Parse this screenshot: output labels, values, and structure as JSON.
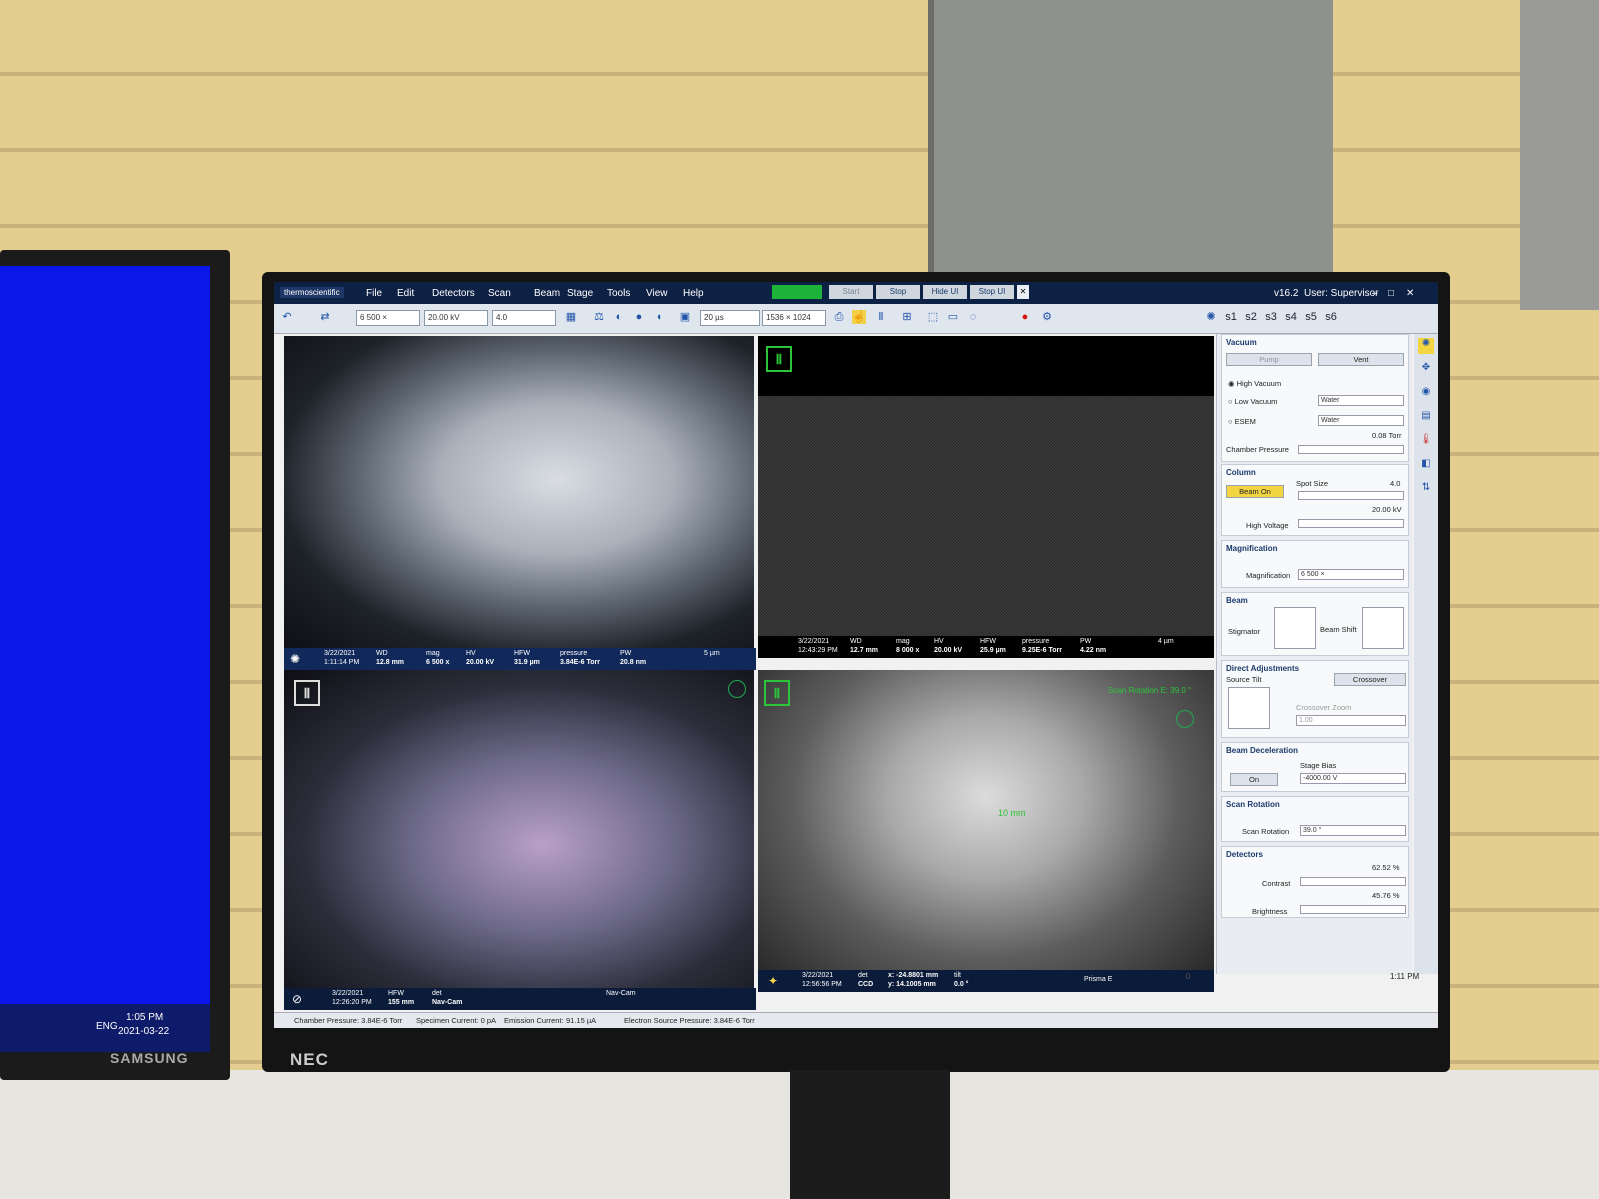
{
  "left_monitor": {
    "brand": "SAMSUNG",
    "time": "1:05 PM",
    "date": "2021-03-22",
    "lang": "ENG"
  },
  "monitor_brand": "NEC",
  "menubar": {
    "logo": "thermoscientific",
    "menus": [
      "File",
      "Edit",
      "Detectors",
      "Scan",
      "Beam",
      "Stage",
      "Tools",
      "View",
      "Help"
    ],
    "start": "Start",
    "stop": "Stop",
    "hide_ui": "Hide UI",
    "stop_ui": "Stop UI",
    "version": "v16.2",
    "user": "User: Supervisor"
  },
  "toolbar": {
    "magnification": "6 500 ×",
    "voltage": "20.00 kV",
    "spot": "4.0",
    "dwell": "20 µs",
    "resolution": "1536 × 1024",
    "slots": [
      "s1",
      "s2",
      "s3",
      "s4",
      "s5",
      "s6"
    ]
  },
  "quad1": {
    "date": "3/22/2021",
    "time": "1:11:14 PM",
    "wd_label": "WD",
    "wd": "12.8 mm",
    "mag_label": "mag",
    "mag": "6 500 x",
    "hv_label": "HV",
    "hv": "20.00 kV",
    "hfw_label": "HFW",
    "hfw": "31.9 µm",
    "pressure_label": "pressure",
    "pressure": "3.84E-6 Torr",
    "pw_label": "PW",
    "pw": "20.8 nm",
    "scale": "5 µm"
  },
  "quad2": {
    "date": "3/22/2021",
    "time": "12:43:29 PM",
    "wd_label": "WD",
    "wd": "12.7 mm",
    "mag_label": "mag",
    "mag": "8 000 x",
    "hv_label": "HV",
    "hv": "20.00 kV",
    "hfw_label": "HFW",
    "hfw": "25.9 µm",
    "pressure_label": "pressure",
    "pressure": "9.25E-6 Torr",
    "pw_label": "PW",
    "pw": "4.22 nm",
    "scale": "4 µm"
  },
  "quad3": {
    "date": "3/22/2021",
    "time": "12:26:20 PM",
    "hfw_label": "HFW",
    "hfw": "155 mm",
    "det_label": "det",
    "det": "Nav-Cam",
    "name": "Nav-Cam"
  },
  "quad4": {
    "date": "3/22/2021",
    "time": "12:56:56 PM",
    "det_label": "det",
    "det": "CCD",
    "x": "x: -24.8801 mm",
    "y": "y: 14.1005 mm",
    "tilt_label": "tilt",
    "tilt": "0.0 °",
    "name": "Prisma E",
    "scan_rotation": "Scan Rotation E: 39.0 °",
    "distance": "10 mm"
  },
  "panel": {
    "vacuum": {
      "title": "Vacuum",
      "pump": "Pump",
      "vent": "Vent",
      "high": "High Vacuum",
      "low": "Low Vacuum",
      "esem": "ESEM",
      "gas1": "Water",
      "gas2": "Water",
      "pressure_value": "0.08 Torr",
      "chamber_pressure": "Chamber Pressure"
    },
    "column": {
      "title": "Column",
      "beam_on": "Beam On",
      "spot_size": "Spot Size",
      "spot_value": "4.0",
      "hv_value": "20.00 kV",
      "high_voltage": "High Voltage"
    },
    "magnification": {
      "title": "Magnification",
      "label": "Magnification",
      "value": "6 500 ×"
    },
    "beam": {
      "title": "Beam",
      "stigmator": "Stigmator",
      "beam_shift": "Beam Shift"
    },
    "direct": {
      "title": "Direct Adjustments",
      "source_tilt": "Source Tilt",
      "crossover": "Crossover",
      "crossover_zoom": "Crossover Zoom",
      "zoom_value": "1.00"
    },
    "decel": {
      "title": "Beam Deceleration",
      "on": "On",
      "stage_bias": "Stage Bias",
      "bias_value": "-4000.00 V"
    },
    "rotation": {
      "title": "Scan Rotation",
      "label": "Scan Rotation",
      "value": "39.0 °"
    },
    "detectors": {
      "title": "Detectors",
      "contrast_value": "62.52 %",
      "contrast": "Contrast",
      "brightness_value": "45.76 %",
      "brightness": "Brightness"
    }
  },
  "status": {
    "chamber": "Chamber Pressure: 3.84E-6 Torr",
    "specimen": "Specimen Current: 0 pA",
    "emission": "Emission Current:",
    "emission_value": "91.15 µA",
    "source": "Electron Source Pressure: 3.84E-6 Torr",
    "clock": "1:11 PM",
    "counter": "0"
  }
}
